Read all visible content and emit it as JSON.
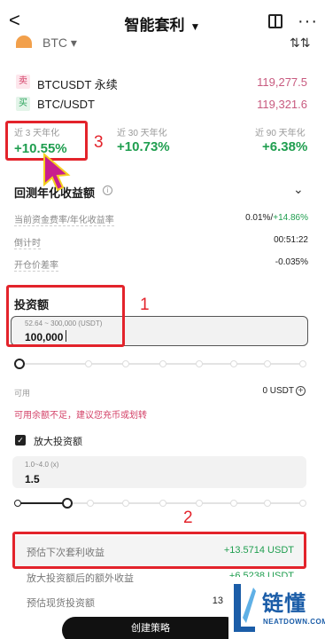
{
  "header": {
    "title": "智能套利",
    "back": "<",
    "more": "···"
  },
  "top": {
    "coin": "BTC",
    "coin_caret": "▾",
    "swap": "⇅⇅"
  },
  "pairs": [
    {
      "tag": "卖",
      "name": "BTCUSDT 永续",
      "price": "119,277.5"
    },
    {
      "tag": "买",
      "name": "BTC/USDT",
      "price": "119,321.6"
    }
  ],
  "apy": [
    {
      "label": "近 3 天年化",
      "value": "+10.55%"
    },
    {
      "label": "近 30 天年化",
      "value": "+10.73%"
    },
    {
      "label": "近 90 天年化",
      "value": "+6.38%"
    }
  ],
  "backtest": {
    "title": "回测年化收益额",
    "info": "i",
    "rows": [
      {
        "label": "当前资金费率/年化收益率",
        "value": "0.01%/",
        "value_green": "+14.86%"
      },
      {
        "label": "倒计时",
        "value": "00:51:22",
        "value_green": ""
      },
      {
        "label": "开仓价差率",
        "value": "-0.035%",
        "value_green": ""
      }
    ]
  },
  "investment": {
    "label": "投资额",
    "hint": "52.64 ~ 300,000 (USDT)",
    "value": "100,000"
  },
  "available": {
    "label": "可用",
    "value": "0 USDT",
    "plus": "+",
    "warning": "可用余额不足，建议您充币或划转"
  },
  "leverage": {
    "checkbox": "✓",
    "label": "放大投资额",
    "hint": "1.0~4.0 (x)",
    "value": "1.5"
  },
  "estimates": [
    {
      "label": "预估下次套利收益",
      "value": "+13.5714 USDT"
    },
    {
      "label": "放大投资额后的额外收益",
      "value": "+6.5238 USDT"
    },
    {
      "label": "预估现货投资额",
      "value": "13"
    }
  ],
  "annotations": [
    "1",
    "2",
    "3"
  ],
  "cta": {
    "label": "创建策略"
  },
  "watermark": {
    "cn": "链懂",
    "en": "NEATDOWN.COM"
  },
  "colors": {
    "green": "#1f9e4f",
    "red_annotation": "#e3232b",
    "price": "#c85a7f"
  }
}
